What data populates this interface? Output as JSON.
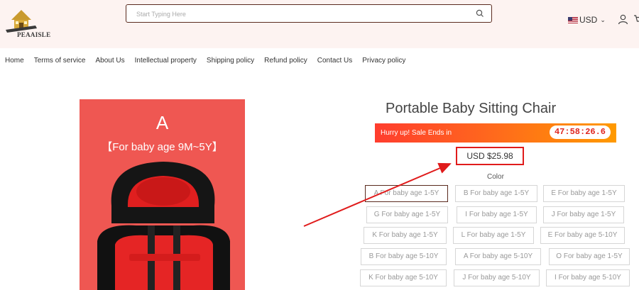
{
  "brand": {
    "logo_text": "PEAAISLE"
  },
  "search": {
    "placeholder": "Start Typing Here"
  },
  "currency": {
    "code": "USD"
  },
  "nav": [
    "Home",
    "Terms of service",
    "About Us",
    "Intellectual property",
    "Shipping policy",
    "Refund policy",
    "Contact Us",
    "Privacy policy"
  ],
  "product": {
    "image_letter": "A",
    "image_age": "【For baby age 9M~5Y】",
    "title": "Portable Baby Sitting Chair",
    "sale_text": "Hurry up! Sale Ends in",
    "timer": "47:58:26.6",
    "price": "USD $25.98",
    "color_label": "Color",
    "options": [
      "A For baby age 1-5Y",
      "B For baby age 1-5Y",
      "E For baby age 1-5Y",
      "G For baby age 1-5Y",
      "I For baby age 1-5Y",
      "J For baby age 1-5Y",
      "K For baby age 1-5Y",
      "L For baby age 1-5Y",
      "E For baby age 5-10Y",
      "B For baby age 5-10Y",
      "A For baby age 5-10Y",
      "O For baby age 1-5Y",
      "K For baby age 5-10Y",
      "J For baby age 5-10Y",
      "I For baby age 5-10Y"
    ],
    "selected_option": "A For baby age 1-5Y"
  },
  "colors": {
    "accent": "#e01b1b",
    "banner": "#ff5a1f",
    "image_bg": "#ef5752"
  }
}
